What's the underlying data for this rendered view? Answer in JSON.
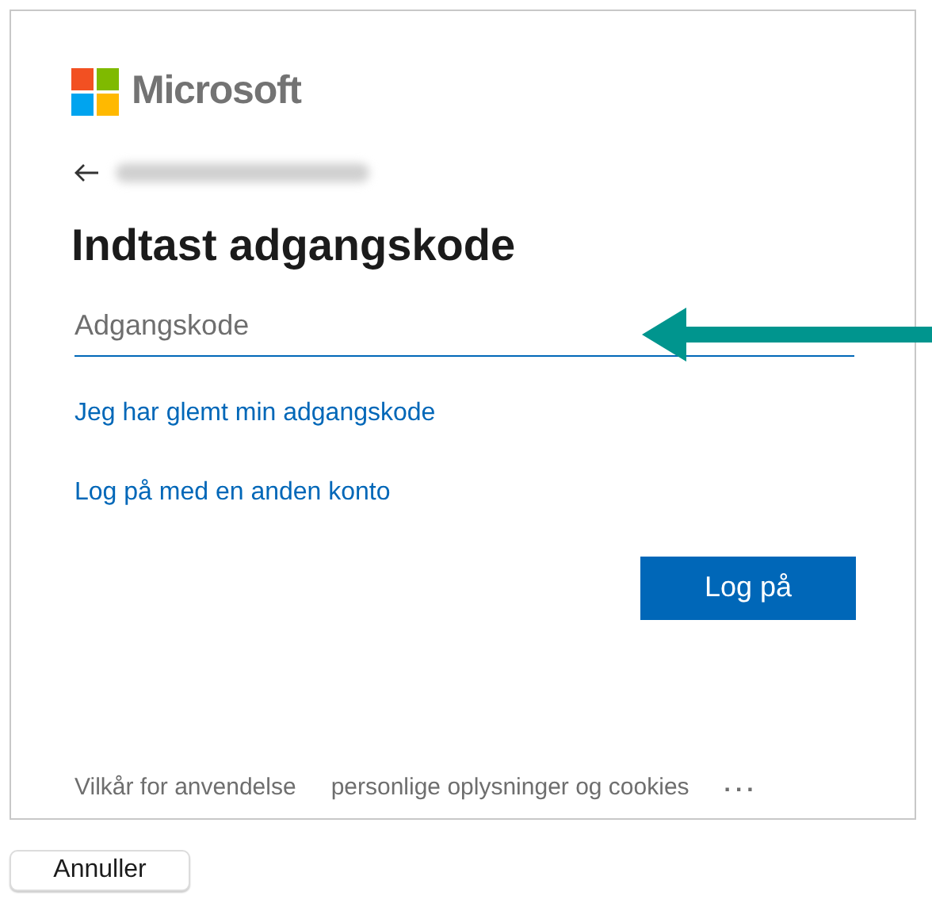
{
  "logo": {
    "text": "Microsoft"
  },
  "heading": "Indtast adgangskode",
  "password_field": {
    "placeholder": "Adgangskode"
  },
  "links": [
    "Jeg har glemt min adgangskode",
    "Log på med en anden konto"
  ],
  "sign_in_button": "Log på",
  "footer": {
    "links": [
      "Vilkår for anvendelse",
      "personlige oplysninger og cookies"
    ],
    "more": "..."
  },
  "cancel_button": "Annuller"
}
